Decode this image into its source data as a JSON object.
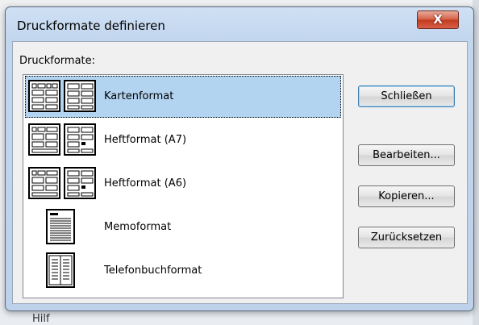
{
  "dialog": {
    "title": "Druckformate definieren",
    "close_label": "X",
    "list_label": "Druckformate:"
  },
  "styles": [
    {
      "label": "Kartenformat",
      "icon": "card-style-icon",
      "selected": true
    },
    {
      "label": "Heftformat (A7)",
      "icon": "booklet-style-icon",
      "selected": false
    },
    {
      "label": "Heftformat (A6)",
      "icon": "booklet-style-icon",
      "selected": false
    },
    {
      "label": "Memoformat",
      "icon": "memo-style-icon",
      "selected": false
    },
    {
      "label": "Telefonbuchformat",
      "icon": "phone-directory-style-icon",
      "selected": false
    }
  ],
  "buttons": {
    "close": "Schließen",
    "edit": "Bearbeiten...",
    "copy": "Kopieren...",
    "reset": "Zurücksetzen"
  },
  "background": {
    "partial_text": "Hilf"
  },
  "colors": {
    "selection": "#b3d4f1",
    "close_button": "#c7432a"
  }
}
